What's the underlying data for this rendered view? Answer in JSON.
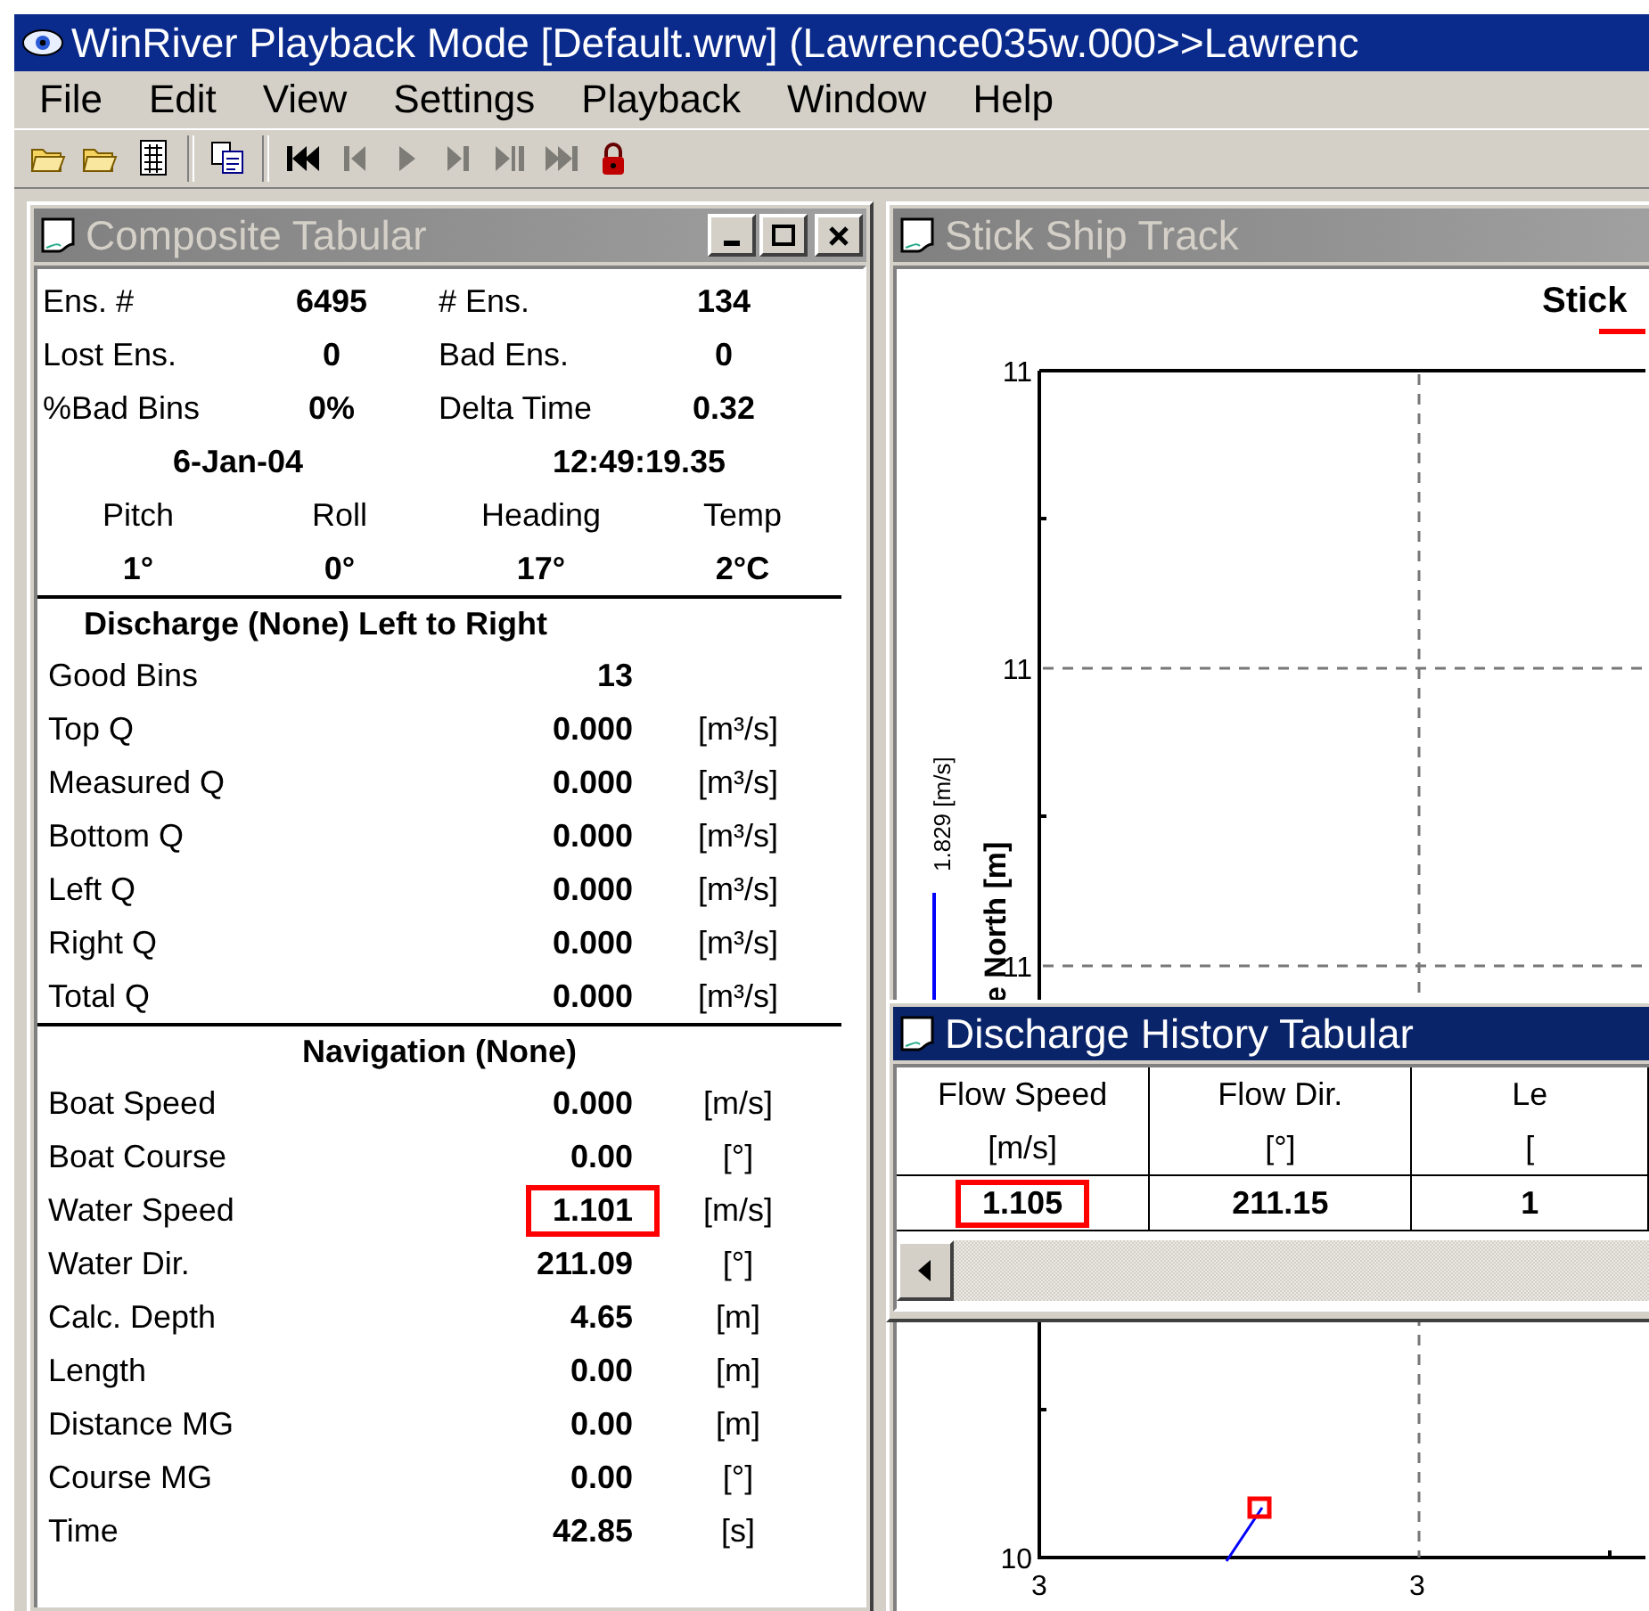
{
  "window": {
    "title": "WinRiver Playback Mode [Default.wrw] (Lawrence035w.000>>Lawrenc"
  },
  "menu": [
    "File",
    "Edit",
    "View",
    "Settings",
    "Playback",
    "Window",
    "Help"
  ],
  "toolbar": [
    {
      "kind": "open",
      "disabled": false
    },
    {
      "kind": "open",
      "disabled": false
    },
    {
      "kind": "grid",
      "disabled": false
    },
    {
      "kind": "copy",
      "disabled": false
    },
    {
      "kind": "first",
      "disabled": false
    },
    {
      "kind": "prev",
      "disabled": true
    },
    {
      "kind": "play",
      "disabled": true
    },
    {
      "kind": "next",
      "disabled": true
    },
    {
      "kind": "step",
      "disabled": true
    },
    {
      "kind": "last",
      "disabled": true
    },
    {
      "kind": "lock",
      "disabled": false
    }
  ],
  "composite": {
    "title": "Composite Tabular",
    "active": false,
    "summary": [
      {
        "label": "Ens. #",
        "value": "6495",
        "label2": "# Ens.",
        "value2": "134"
      },
      {
        "label": "Lost Ens.",
        "value": "0",
        "label2": "Bad Ens.",
        "value2": "0"
      },
      {
        "label": "%Bad Bins",
        "value": "0%",
        "label2": "Delta Time",
        "value2": "0.32"
      }
    ],
    "date": "6-Jan-04",
    "time": "12:49:19.35",
    "attitude": [
      {
        "label": "Pitch",
        "value": "1°"
      },
      {
        "label": "Roll",
        "value": "0°"
      },
      {
        "label": "Heading",
        "value": "17°"
      },
      {
        "label": "Temp",
        "value": "2°C"
      }
    ],
    "discharge": {
      "heading": "Discharge (None) Left to Right",
      "rows": [
        {
          "label": "Good Bins",
          "value": "13",
          "highlighted": false
        },
        {
          "label": "Top Q",
          "value": "0.000",
          "unit": "[m³/s]",
          "highlighted": false
        },
        {
          "label": "Measured Q",
          "value": "0.000",
          "unit": "[m³/s]",
          "highlighted": false
        },
        {
          "label": "Bottom Q",
          "value": "0.000",
          "unit": "[m³/s]",
          "highlighted": false
        },
        {
          "label": "Left Q",
          "value": "0.000",
          "unit": "[m³/s]",
          "highlighted": false
        },
        {
          "label": "Right Q",
          "value": "0.000",
          "unit": "[m³/s]",
          "highlighted": false
        },
        {
          "label": "Total Q",
          "value": "0.000",
          "unit": "[m³/s]",
          "highlighted": false
        }
      ]
    },
    "navigation": {
      "heading": "Navigation (None)",
      "rows": [
        {
          "label": "Boat Speed",
          "value": "0.000",
          "unit": "[m/s]",
          "highlighted": false
        },
        {
          "label": "Boat Course",
          "value": "0.00",
          "unit": "[°]",
          "highlighted": false
        },
        {
          "label": "Water Speed",
          "value": "1.101",
          "unit": "[m/s]",
          "highlighted": true
        },
        {
          "label": "Water Dir.",
          "value": "211.09",
          "unit": "[°]",
          "highlighted": false
        },
        {
          "label": "Calc. Depth",
          "value": "4.65",
          "unit": "[m]",
          "highlighted": false
        },
        {
          "label": "Length",
          "value": "0.00",
          "unit": "[m]",
          "highlighted": false
        },
        {
          "label": "Distance MG",
          "value": "0.00",
          "unit": "[m]",
          "highlighted": false
        },
        {
          "label": "Course MG",
          "value": "0.00",
          "unit": "[°]",
          "highlighted": false
        },
        {
          "label": "Time",
          "value": "42.85",
          "unit": "[s]",
          "highlighted": false
        }
      ]
    }
  },
  "ship_track": {
    "title": "Stick Ship Track",
    "active": false,
    "chart": {
      "title": "Stick",
      "legend": "1.829 [m/s]",
      "ylabel": "e North [m]",
      "yticks": [
        "11",
        "11",
        "11",
        "10"
      ],
      "xticks": [
        "3",
        "3"
      ]
    }
  },
  "discharge_history": {
    "title": "Discharge History Tabular",
    "active": true,
    "columns": [
      {
        "name": "Flow Speed",
        "unit": "[m/s]"
      },
      {
        "name": "Flow Dir.",
        "unit": "[°]"
      },
      {
        "name": "Le",
        "unit": "["
      }
    ],
    "rows": [
      [
        {
          "text": "1.105",
          "highlighted": true
        },
        {
          "text": "211.15",
          "highlighted": false
        },
        {
          "text": "1",
          "highlighted": false
        }
      ]
    ]
  }
}
